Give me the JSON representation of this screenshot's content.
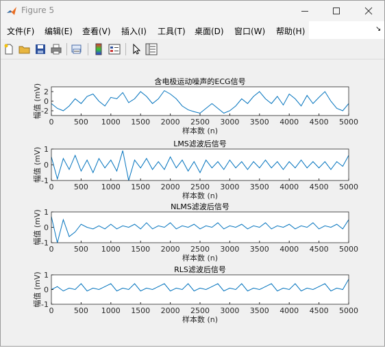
{
  "window": {
    "title": "Figure 5",
    "controls": [
      "minimize",
      "maximize",
      "close"
    ],
    "app_icon": "matlab-logo-icon"
  },
  "menu": {
    "items": [
      "文件(F)",
      "编辑(E)",
      "查看(V)",
      "插入(I)",
      "工具(T)",
      "桌面(D)",
      "窗口(W)",
      "帮助(H)"
    ],
    "overflow_icon": "menu-overflow-arrow-icon"
  },
  "toolbar": {
    "icons": [
      "new-figure-icon",
      "open-file-icon",
      "save-icon",
      "print-icon",
      "link-plot-icon",
      "insert-colorbar-icon",
      "insert-legend-icon",
      "edit-plot-arrow-icon",
      "property-inspector-icon"
    ]
  },
  "colors": {
    "line": "#0072BD",
    "axes_bg": "#ffffff",
    "figure_bg": "#f0f0f0"
  },
  "chart_data": [
    {
      "type": "line",
      "title": "含电极运动噪声的ECG信号",
      "xlabel": "样本数 (n)",
      "ylabel": "幅值 (mV)",
      "xlim": [
        0,
        5000
      ],
      "ylim": [
        -3,
        3
      ],
      "xticks": [
        0,
        500,
        1000,
        1500,
        2000,
        2500,
        3000,
        3500,
        4000,
        4500,
        5000
      ],
      "yticks": [
        -2,
        0,
        2
      ],
      "series": [
        {
          "x": [
            0,
            100,
            200,
            300,
            400,
            500,
            600,
            700,
            800,
            900,
            1000,
            1100,
            1200,
            1300,
            1400,
            1500,
            1600,
            1700,
            1800,
            1900,
            2000,
            2100,
            2200,
            2300,
            2400,
            2500,
            2600,
            2700,
            2800,
            2900,
            3000,
            3100,
            3200,
            3300,
            3400,
            3500,
            3600,
            3700,
            3800,
            3900,
            4000,
            4100,
            4200,
            4300,
            4400,
            4500,
            4600,
            4700,
            4800,
            4900,
            5000
          ],
          "values": [
            -0.5,
            -1.5,
            -2.0,
            -1.0,
            0.5,
            -0.5,
            1.0,
            1.5,
            0.0,
            -1.0,
            0.8,
            0.5,
            1.8,
            -0.3,
            0.5,
            2.0,
            1.0,
            -0.5,
            0.5,
            2.2,
            1.5,
            0.5,
            -1.0,
            -1.8,
            -2.2,
            -2.5,
            -1.5,
            -0.5,
            -1.5,
            -2.5,
            -2.0,
            -1.0,
            0.5,
            -0.5,
            1.0,
            2.0,
            0.5,
            -0.5,
            1.0,
            -0.8,
            1.5,
            0.5,
            -1.0,
            1.2,
            -0.5,
            0.8,
            2.0,
            0.0,
            -1.5,
            -2.0,
            -0.5
          ]
        }
      ]
    },
    {
      "type": "line",
      "title": "LMS滤波后信号",
      "xlabel": "样本数 (n)",
      "ylabel": "幅值 (mV)",
      "xlim": [
        0,
        5000
      ],
      "ylim": [
        -1,
        1
      ],
      "xticks": [
        0,
        500,
        1000,
        1500,
        2000,
        2500,
        3000,
        3500,
        4000,
        4500,
        5000
      ],
      "yticks": [
        -1,
        0,
        1
      ],
      "series": [
        {
          "x": [
            0,
            100,
            200,
            300,
            400,
            500,
            600,
            700,
            800,
            900,
            1000,
            1100,
            1200,
            1300,
            1400,
            1500,
            1600,
            1700,
            1800,
            1900,
            2000,
            2100,
            2200,
            2300,
            2400,
            2500,
            2600,
            2700,
            2800,
            2900,
            3000,
            3100,
            3200,
            3300,
            3400,
            3500,
            3600,
            3700,
            3800,
            3900,
            4000,
            4100,
            4200,
            4300,
            4400,
            4500,
            4600,
            4700,
            4800,
            4900,
            5000
          ],
          "values": [
            0.5,
            -0.9,
            0.4,
            -0.3,
            0.6,
            -0.4,
            0.3,
            -0.5,
            0.4,
            -0.2,
            0.3,
            -0.4,
            0.9,
            -1.0,
            0.3,
            -0.2,
            0.4,
            -0.3,
            0.2,
            -0.3,
            0.5,
            -0.2,
            0.3,
            -0.4,
            0.2,
            -0.5,
            0.3,
            -0.2,
            0.2,
            -0.3,
            0.3,
            -0.2,
            0.2,
            -0.3,
            0.2,
            -0.2,
            0.3,
            -0.2,
            0.2,
            -0.3,
            0.2,
            -0.2,
            0.3,
            -0.2,
            0.2,
            -0.2,
            0.2,
            -0.3,
            0.2,
            -0.1,
            0.6
          ]
        }
      ]
    },
    {
      "type": "line",
      "title": "NLMS滤波后信号",
      "xlabel": "样本数 (n)",
      "ylabel": "幅值 (mV)",
      "xlim": [
        0,
        5000
      ],
      "ylim": [
        -1,
        1
      ],
      "xticks": [
        0,
        500,
        1000,
        1500,
        2000,
        2500,
        3000,
        3500,
        4000,
        4500,
        5000
      ],
      "yticks": [
        -1,
        0,
        1
      ],
      "series": [
        {
          "x": [
            0,
            100,
            200,
            300,
            400,
            500,
            600,
            700,
            800,
            900,
            1000,
            1100,
            1200,
            1300,
            1400,
            1500,
            1600,
            1700,
            1800,
            1900,
            2000,
            2100,
            2200,
            2300,
            2400,
            2500,
            2600,
            2700,
            2800,
            2900,
            3000,
            3100,
            3200,
            3300,
            3400,
            3500,
            3600,
            3700,
            3800,
            3900,
            4000,
            4100,
            4200,
            4300,
            4400,
            4500,
            4600,
            4700,
            4800,
            4900,
            5000
          ],
          "values": [
            0.7,
            -1.0,
            0.5,
            -0.6,
            -0.3,
            0.2,
            0.0,
            -0.1,
            0.1,
            -0.1,
            0.2,
            -0.1,
            0.1,
            0.0,
            0.2,
            -0.1,
            0.3,
            -0.1,
            0.1,
            0.0,
            0.3,
            -0.1,
            0.1,
            0.0,
            0.2,
            -0.1,
            0.1,
            0.0,
            0.3,
            -0.1,
            0.1,
            0.0,
            0.2,
            -0.1,
            0.1,
            0.0,
            0.3,
            -0.1,
            0.1,
            0.0,
            0.2,
            -0.1,
            0.1,
            0.0,
            0.3,
            -0.1,
            0.1,
            0.0,
            0.2,
            -0.1,
            0.5
          ]
        }
      ]
    },
    {
      "type": "line",
      "title": "RLS滤波后信号",
      "xlabel": "样本数 (n)",
      "ylabel": "幅值 (mV)",
      "xlim": [
        0,
        5000
      ],
      "ylim": [
        -1,
        1
      ],
      "xticks": [
        0,
        500,
        1000,
        1500,
        2000,
        2500,
        3000,
        3500,
        4000,
        4500,
        5000
      ],
      "yticks": [
        -1,
        0,
        1
      ],
      "series": [
        {
          "x": [
            0,
            100,
            200,
            300,
            400,
            500,
            600,
            700,
            800,
            900,
            1000,
            1100,
            1200,
            1300,
            1400,
            1500,
            1600,
            1700,
            1800,
            1900,
            2000,
            2100,
            2200,
            2300,
            2400,
            2500,
            2600,
            2700,
            2800,
            2900,
            3000,
            3100,
            3200,
            3300,
            3400,
            3500,
            3600,
            3700,
            3800,
            3900,
            4000,
            4100,
            4200,
            4300,
            4400,
            4500,
            4600,
            4700,
            4800,
            4900,
            5000
          ],
          "values": [
            0.0,
            0.2,
            -0.1,
            0.1,
            0.0,
            0.4,
            -0.1,
            0.1,
            0.0,
            0.2,
            0.4,
            -0.1,
            0.1,
            0.0,
            0.4,
            -0.1,
            0.1,
            0.0,
            0.2,
            0.4,
            -0.1,
            0.1,
            0.0,
            0.4,
            -0.1,
            0.1,
            0.0,
            0.2,
            0.4,
            -0.1,
            0.1,
            0.0,
            0.4,
            -0.1,
            0.1,
            0.0,
            0.2,
            0.4,
            -0.1,
            0.1,
            0.0,
            0.4,
            -0.1,
            0.1,
            0.0,
            0.2,
            0.4,
            -0.1,
            0.1,
            0.0,
            0.7
          ]
        }
      ]
    }
  ]
}
